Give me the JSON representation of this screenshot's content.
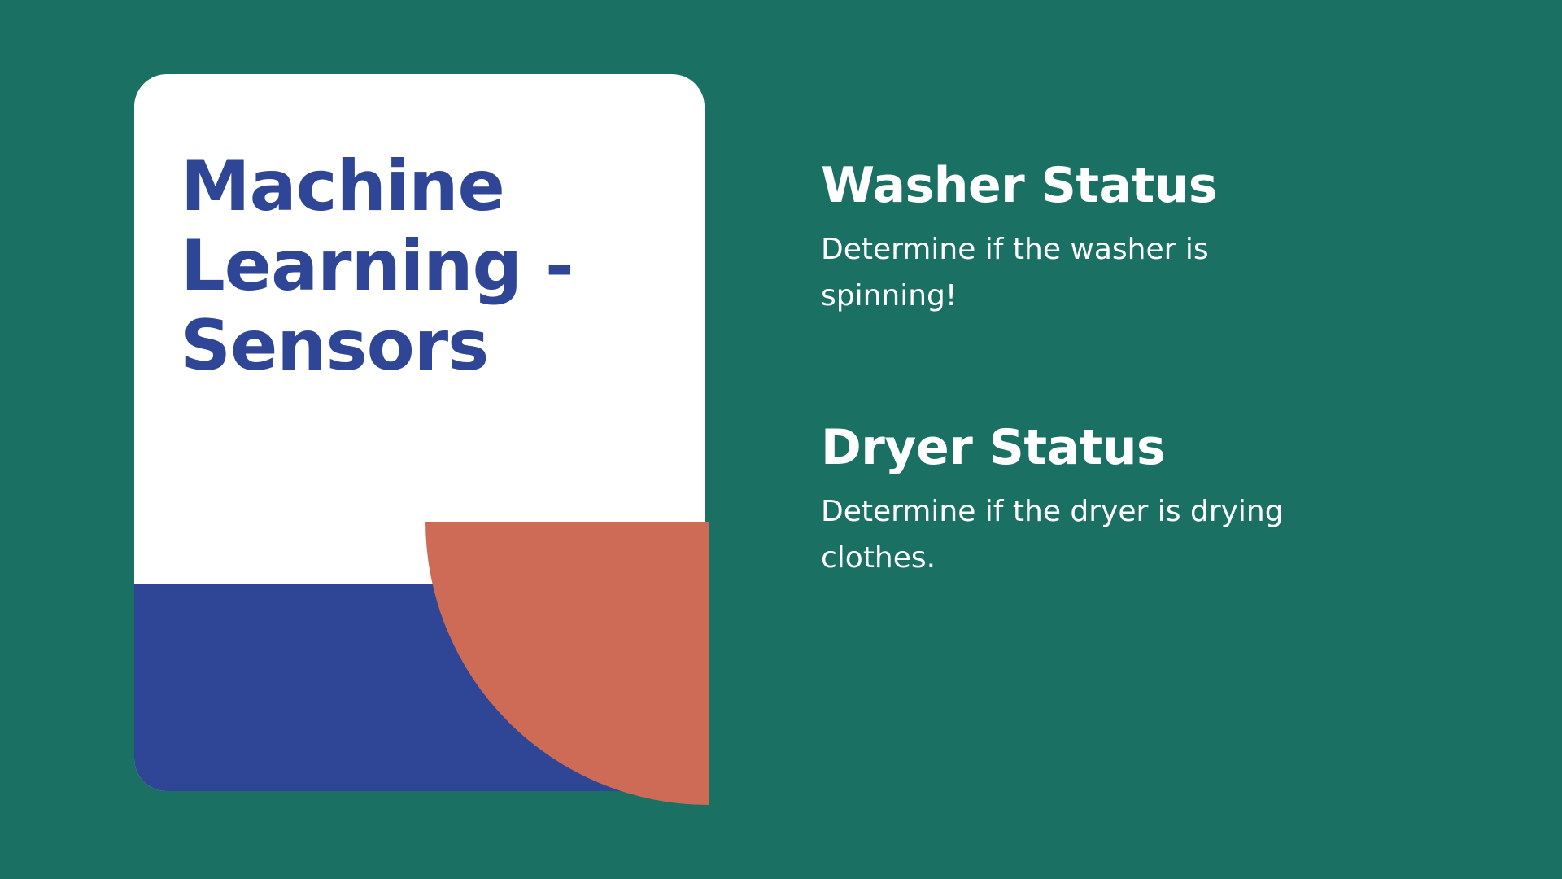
{
  "slide": {
    "title": "Machine Learning - Sensors",
    "sections": [
      {
        "heading": "Washer Status",
        "description": "Determine if the washer is spinning!"
      },
      {
        "heading": "Dryer Status",
        "description": "Determine if the dryer is drying clothes."
      }
    ]
  },
  "colors": {
    "background": "#1b7064",
    "card": "#ffffff",
    "accent_blue": "#2f4595",
    "accent_coral": "#cd6b56",
    "text_light": "#ffffff"
  }
}
